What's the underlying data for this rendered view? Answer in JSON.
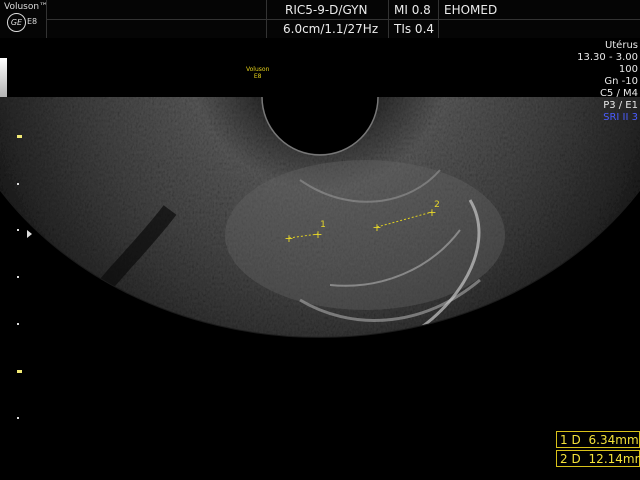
{
  "header": {
    "brand": "Voluson™",
    "brand_model": "E8",
    "logo_text": "GE",
    "probe": "RIC5-9-D/GYN",
    "mi": "MI  0.8",
    "institution": "EHOMED",
    "depth_freq": "6.0cm/1.1/27Hz",
    "tis": "TIs  0.4"
  },
  "params": {
    "title": "Utérus",
    "lines": [
      "13.30 - 3.00",
      "100",
      "Gn -10",
      "C5 / M4",
      "P3 / E1",
      "SRI II 3"
    ],
    "sri_color": "#4a5cff"
  },
  "overlay_logo": {
    "line1": "Voluson",
    "line2": "E8"
  },
  "calipers": [
    {
      "label": "1",
      "start": "+",
      "end": "+"
    },
    {
      "label": "2",
      "start": "+",
      "end": "+"
    }
  ],
  "measurements": [
    {
      "index": "1",
      "type": "D",
      "value": "6.34mm"
    },
    {
      "index": "2",
      "type": "D",
      "value": "12.14mm"
    }
  ],
  "colors": {
    "accent": "#f4e23a",
    "box_border": "#d9c21a"
  }
}
